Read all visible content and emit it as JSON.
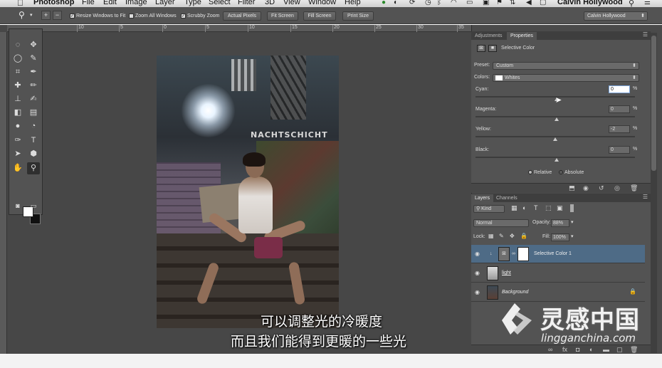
{
  "menubar": {
    "app": "Photoshop",
    "items": [
      "File",
      "Edit",
      "Image",
      "Layer",
      "Type",
      "Select",
      "Filter",
      "3D",
      "View",
      "Window",
      "Help"
    ],
    "user": "Calvin Hollywood"
  },
  "options": {
    "resize_windows": "Resize Windows to Fit",
    "zoom_all": "Zoom All Windows",
    "scrubby_zoom": "Scrubby Zoom",
    "actual_pixels": "Actual Pixels",
    "fit_screen": "Fit Screen",
    "fill_screen": "Fill Screen",
    "print_size": "Print Size",
    "workspace": "Calvin Hollywood"
  },
  "ruler": {
    "ticks": [
      "10",
      "5",
      "0",
      "5",
      "10",
      "15",
      "20",
      "25",
      "30",
      "35"
    ]
  },
  "document": {
    "sign_text": "NACHTSCHICHT"
  },
  "panels": {
    "tab_adjustments": "Adjustments",
    "tab_properties": "Properties",
    "title": "Selective Color",
    "preset_label": "Preset:",
    "preset_value": "Custom",
    "colors_label": "Colors:",
    "colors_value": "Whites",
    "cyan_label": "Cyan:",
    "cyan_value": "0",
    "magenta_label": "Magenta:",
    "magenta_value": "0",
    "yellow_label": "Yellow:",
    "yellow_value": "-2",
    "black_label": "Black:",
    "black_value": "0",
    "pct": "%",
    "relative": "Relative",
    "absolute": "Absolute"
  },
  "layers": {
    "tab_layers": "Layers",
    "tab_channels": "Channels",
    "kind": "Kind",
    "blend_mode": "Normal",
    "opacity_label": "Opacity:",
    "opacity_value": "88%",
    "lock_label": "Lock:",
    "fill_label": "Fill:",
    "fill_value": "100%",
    "items": [
      "Selective Color 1",
      "light",
      "Background"
    ]
  },
  "subtitles": {
    "line1": "可以调整光的冷暖度",
    "line2": "而且我们能得到更暖的一些光"
  },
  "watermark": {
    "cn": "灵感中国",
    "en": "lingganchina.com"
  }
}
